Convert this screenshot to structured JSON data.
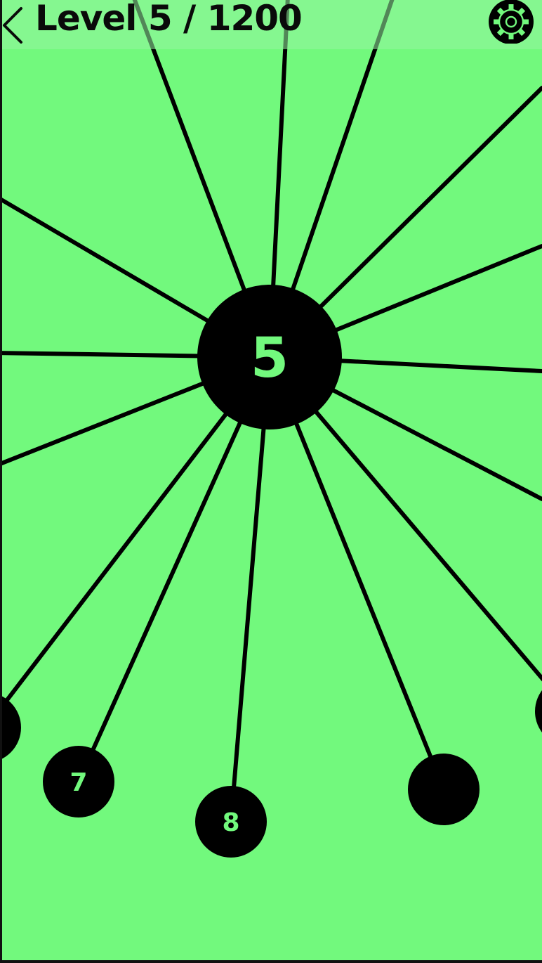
{
  "header": {
    "level_text": "Level 5 / 1200",
    "back_icon": "chevron-left-icon",
    "settings_icon": "gear-icon"
  },
  "game": {
    "remaining_pins": "5",
    "fired_balls": [
      {
        "label": ""
      },
      {
        "label": "7"
      },
      {
        "label": "8"
      },
      {
        "label": ""
      },
      {
        "label": ""
      }
    ]
  },
  "colors": {
    "background": "#72f97d",
    "header_overlay": "#96f5a0",
    "ink": "#000000"
  }
}
